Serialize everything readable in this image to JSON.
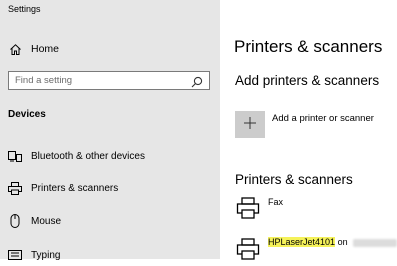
{
  "window": {
    "title": "Settings"
  },
  "sidebar": {
    "home_label": "Home",
    "search_placeholder": "Find a setting",
    "section": "Devices",
    "items": [
      {
        "label": "Bluetooth & other devices",
        "icon": "bluetooth-devices-icon"
      },
      {
        "label": "Printers & scanners",
        "icon": "printer-icon"
      },
      {
        "label": "Mouse",
        "icon": "mouse-icon"
      },
      {
        "label": "Typing",
        "icon": "keyboard-icon"
      }
    ]
  },
  "main": {
    "title": "Printers & scanners",
    "add_heading": "Add printers & scanners",
    "add_button_label": "Add a printer or scanner",
    "list_heading": "Printers & scanners",
    "devices": [
      {
        "name": "Fax",
        "icon": "printer-icon"
      },
      {
        "name": "HPLaserJet4101",
        "on_text": "on",
        "icon": "printer-icon"
      }
    ]
  },
  "colors": {
    "sidebar_bg": "#e6e6e6",
    "highlight": "#f5f25a",
    "add_tile_bg": "#cccccc"
  }
}
